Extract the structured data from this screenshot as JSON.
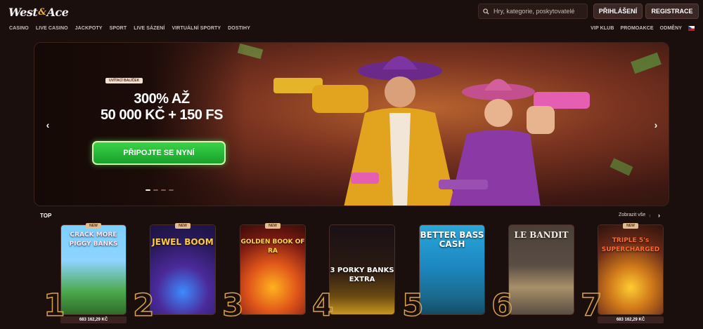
{
  "header": {
    "logo": {
      "part1": "West",
      "amp": "&",
      "part2": "Ace"
    },
    "search_placeholder": "Hry, kategorie, poskytovatelé",
    "login_label": "PŘIHLÁŠENÍ",
    "register_label": "REGISTRACE"
  },
  "nav": {
    "left": [
      "CASINO",
      "LIVE CASINO",
      "JACKPOTY",
      "SPORT",
      "LIVE SÁZENÍ",
      "VIRTUÁLNÍ SPORTY",
      "DOSTIHY"
    ],
    "right": [
      "VIP KLUB",
      "PROMOAKCE",
      "ODMĚNY"
    ],
    "language_flag": "czech-flag-icon"
  },
  "banner": {
    "badge": "UVÍTACÍ BALÍČEK",
    "headline_line1": "300% AŽ",
    "headline_line2": "50 000 KČ + 150 FS",
    "cta_label": "PŘIPOJTE SE NYNÍ",
    "slides_total": 4,
    "active_slide": 1
  },
  "top_section": {
    "label": "TOP",
    "view_all": "Zobrazit vše",
    "games": [
      {
        "rank": "1",
        "title": "CRACK MORE PIGGY BANKS",
        "new": "NEW",
        "jackpot": "683 162,29 KČ"
      },
      {
        "rank": "2",
        "title": "JEWEL BOOM",
        "new": "NEW",
        "jackpot": ""
      },
      {
        "rank": "3",
        "title": "GOLDEN BOOK OF RA",
        "new": "NEW",
        "jackpot": ""
      },
      {
        "rank": "4",
        "title": "3 PORKY BANKS EXTRA",
        "new": "",
        "jackpot": ""
      },
      {
        "rank": "5",
        "title": "BETTER BASS CASH",
        "new": "",
        "jackpot": ""
      },
      {
        "rank": "6",
        "title": "LE BANDIT",
        "new": "",
        "jackpot": ""
      },
      {
        "rank": "7",
        "title": "TRIPLE 5's SUPERCHARGED",
        "new": "NEW",
        "jackpot": "683 162,29 KČ"
      }
    ]
  },
  "colors": {
    "background": "#1a0f0d",
    "cta_green": "#26b935",
    "rank_gold": "#d6a24a",
    "badge_cream": "#e1bd8d"
  }
}
